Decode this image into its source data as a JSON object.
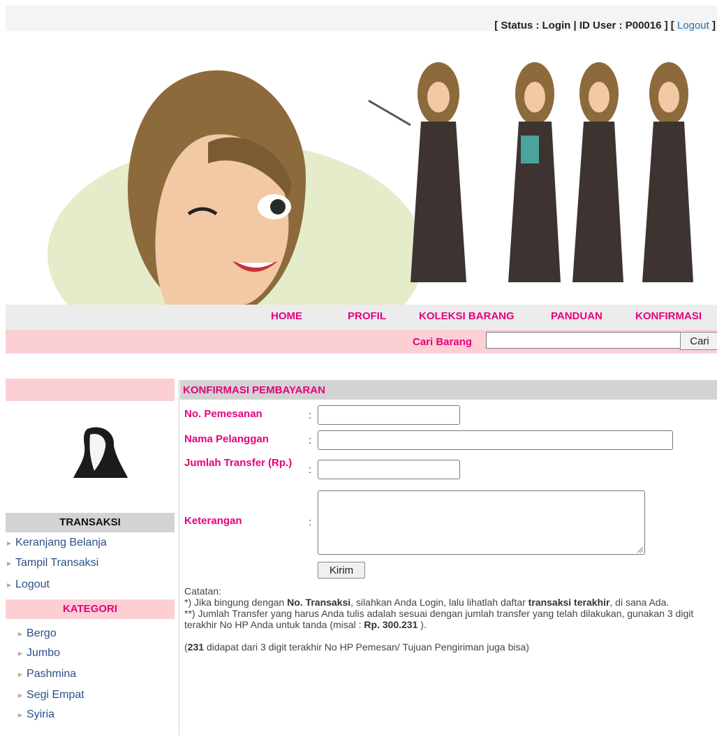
{
  "status_bar": {
    "status_text": "[ Status : Login | ID User : P00016 ] [ ",
    "logout_link": "Logout",
    "close_bracket": " ]"
  },
  "nav": {
    "home": "HOME",
    "profil": "PROFIL",
    "koleksi": "KOLEKSI BARANG",
    "panduan": "PANDUAN",
    "konfirmasi": "KONFIRMASI"
  },
  "search": {
    "label": "Cari Barang",
    "value": "",
    "button": "Cari"
  },
  "sidebar": {
    "transaksi_heading": "TRANSAKSI",
    "transaksi_links": [
      "Keranjang Belanja",
      "Tampil Transaksi",
      "Logout"
    ],
    "kategori_heading": "KATEGORI",
    "kategori_links": [
      "Bergo",
      "Jumbo",
      "Pashmina",
      "Segi Empat",
      "Syiria"
    ]
  },
  "form": {
    "title": "KONFIRMASI PEMBAYARAN",
    "no_pemesanan_label": "No. Pemesanan",
    "no_pemesanan_value": "",
    "nama_pelanggan_label": "Nama Pelanggan",
    "nama_pelanggan_value": "",
    "jumlah_transfer_label": "Jumlah Transfer (Rp.)",
    "jumlah_transfer_value": "",
    "keterangan_label": "Keterangan",
    "keterangan_value": "",
    "colon": ":",
    "submit": "Kirim"
  },
  "notes": {
    "heading": "Catatan:",
    "line1_a": "*) Jika bingung dengan ",
    "line1_b": "No. Transaksi",
    "line1_c": ", silahkan Anda Login, lalu lihatlah daftar ",
    "line1_d": "transaksi terakhir",
    "line1_e": ", di sana Ada.",
    "line2_a": "**) Jumlah Transfer yang harus Anda tulis adalah sesuai dengan jumlah transfer yang telah dilakukan, gunakan 3 digit terakhir No HP Anda untuk tanda (misal : ",
    "line2_b": "Rp. 300.231",
    "line2_c": " ).",
    "line3_open": "(",
    "line3_b": "231",
    "line3_c": " didapat dari 3 digit terakhir No HP Pemesan/ Tujuan Pengiriman juga bisa)"
  },
  "colors": {
    "accent_pink": "#e6007e",
    "light_pink": "#fbcfd4",
    "header_gray": "#d3d3d3",
    "link_blue": "#2a4f8a"
  }
}
